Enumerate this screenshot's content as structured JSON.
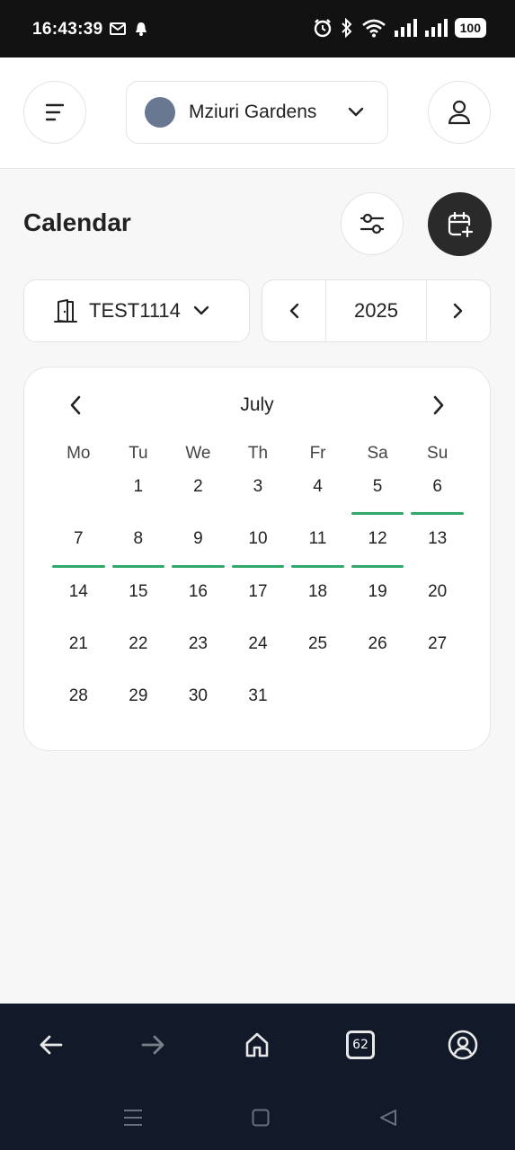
{
  "status_bar": {
    "time": "16:43:39",
    "battery": "100",
    "icons": [
      "mail-icon",
      "notification-bell-icon",
      "alarm-icon",
      "bluetooth-icon",
      "wifi-icon",
      "signal-icon",
      "signal-icon",
      "battery-icon"
    ]
  },
  "header": {
    "org_name": "Mziuri Gardens",
    "org_color": "#687891"
  },
  "calendar": {
    "title": "Calendar",
    "room_label": "TEST1114",
    "year": "2025",
    "month": "July",
    "weekdays": [
      "Mo",
      "Tu",
      "We",
      "Th",
      "Fr",
      "Sa",
      "Su"
    ],
    "leading_blanks": 1,
    "days": [
      "1",
      "2",
      "3",
      "4",
      "5",
      "6",
      "7",
      "8",
      "9",
      "10",
      "11",
      "12",
      "13",
      "14",
      "15",
      "16",
      "17",
      "18",
      "19",
      "20",
      "21",
      "22",
      "23",
      "24",
      "25",
      "26",
      "27",
      "28",
      "29",
      "30",
      "31"
    ],
    "marked_days": [
      "5",
      "6",
      "7",
      "8",
      "9",
      "10",
      "11",
      "12"
    ],
    "mark_color": "#2fa86a"
  },
  "browser_bar": {
    "tab_count": "62"
  }
}
